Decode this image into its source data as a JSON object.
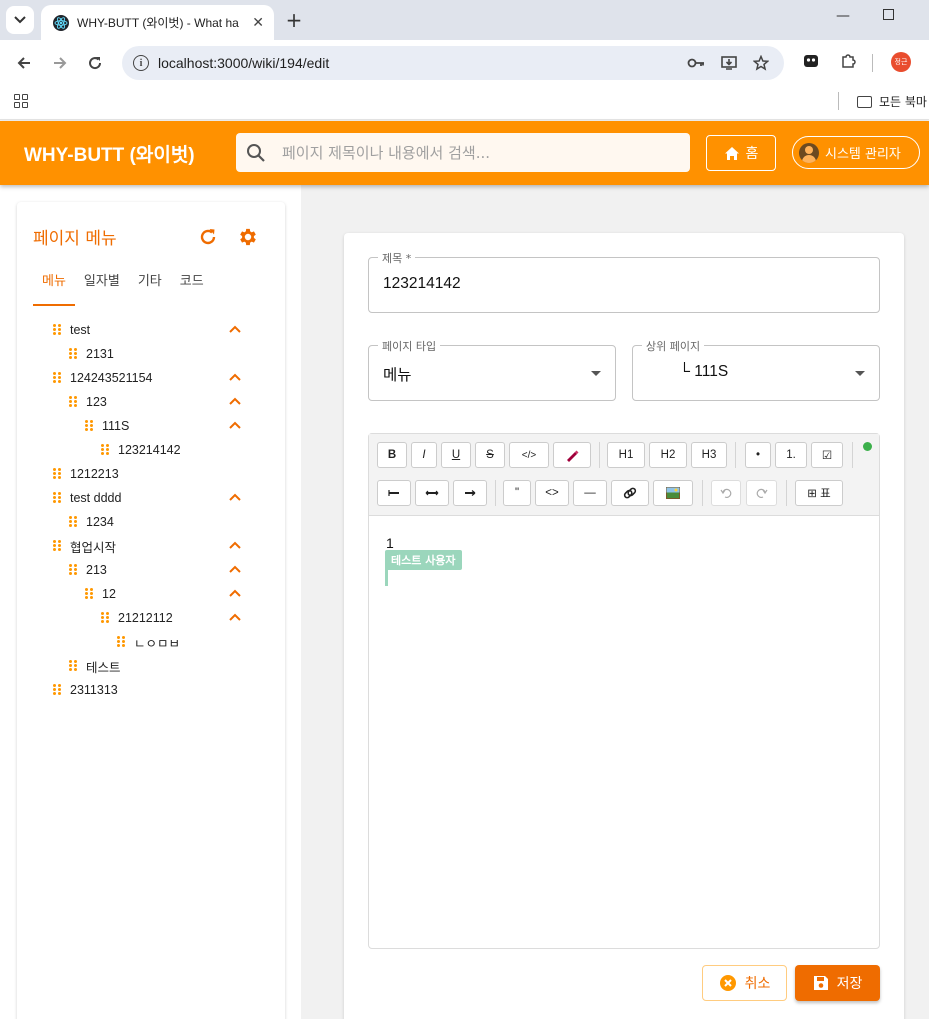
{
  "browser": {
    "tab_title": "WHY-BUTT (와이벗) - What ha",
    "url": "localhost:3000/wiki/194/edit",
    "bookmark_folder": "모든 북마",
    "profile_initials": "정근"
  },
  "header": {
    "brand": "WHY-BUTT (와이벗)",
    "search_placeholder": "페이지 제목이나 내용에서 검색...",
    "home_label": "홈",
    "user_label": "시스템 관리자",
    "accent_color": "#ff9100"
  },
  "sidebar": {
    "title": "페이지 메뉴",
    "tabs": [
      "메뉴",
      "일자별",
      "기타",
      "코드"
    ],
    "active_tab": "메뉴",
    "tree": [
      {
        "label": "test",
        "expanded": true
      },
      {
        "label": "2131"
      },
      {
        "label": "124243521154",
        "expanded": true
      },
      {
        "label": "123",
        "expanded": true
      },
      {
        "label": "111S",
        "expanded": true
      },
      {
        "label": "123214142"
      },
      {
        "label": "1212213"
      },
      {
        "label": "test dddd",
        "expanded": true
      },
      {
        "label": "1234"
      },
      {
        "label": "협업시작",
        "expanded": true
      },
      {
        "label": "213",
        "expanded": true
      },
      {
        "label": "12",
        "expanded": true
      },
      {
        "label": "21212112",
        "expanded": true
      },
      {
        "label": "ㄴㅇㅁㅂ"
      },
      {
        "label": "테스트"
      },
      {
        "label": "2311313"
      }
    ]
  },
  "form": {
    "title_label": "제목 *",
    "title_value": "123214142",
    "page_type_label": "페이지 타입",
    "page_type_value": "메뉴",
    "parent_label": "상위 페이지",
    "parent_value": "└ 111S"
  },
  "editor": {
    "toolbar_row1": [
      "B",
      "I",
      "U",
      "S",
      "</>",
      "highlight",
      "H1",
      "H2",
      "H3",
      "•",
      "1.",
      "☑"
    ],
    "toolbar_row2": [
      "align-left",
      "align-center",
      "align-right",
      "\"",
      "<>",
      "—",
      "link",
      "image",
      "undo",
      "redo",
      "⊞ 표"
    ],
    "content": "1",
    "collaborator": "테스트 사용자",
    "connection_color": "#3cb04b"
  },
  "actions": {
    "cancel_label": "취소",
    "save_label": "저장"
  }
}
